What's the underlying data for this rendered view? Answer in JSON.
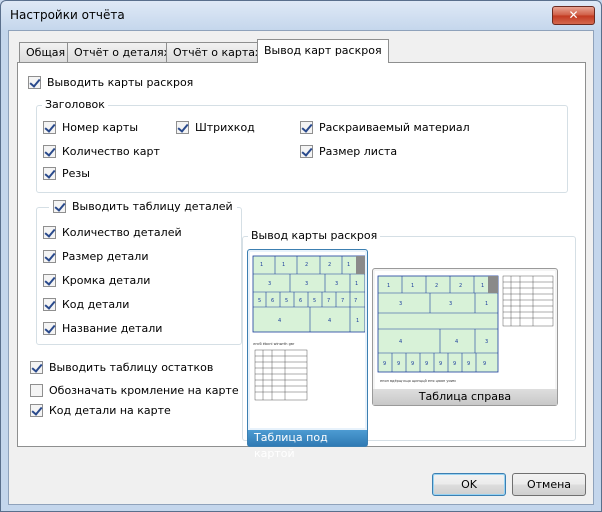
{
  "window": {
    "title": "Настройки отчёта",
    "close_glyph": "✕"
  },
  "tabs": [
    {
      "label": "Общая"
    },
    {
      "label": "Отчёт о деталях"
    },
    {
      "label": "Отчёт о картах"
    },
    {
      "label": "Вывод карт раскроя"
    }
  ],
  "active_tab": 3,
  "main": {
    "output_cards": {
      "label": "Выводить карты раскроя",
      "checked": true
    },
    "header_group": {
      "legend": "Заголовок",
      "items": [
        {
          "label": "Номер карты",
          "checked": true
        },
        {
          "label": "Количество карт",
          "checked": true
        },
        {
          "label": "Резы",
          "checked": true
        },
        {
          "label": "Штрихкод",
          "checked": true
        },
        {
          "label": "Раскраиваемый материал",
          "checked": true
        },
        {
          "label": "Размер листа",
          "checked": true
        }
      ]
    },
    "details_group": {
      "legend": "Выводить таблицу деталей",
      "legend_checked": true,
      "items": [
        {
          "label": "Количество деталей",
          "checked": true
        },
        {
          "label": "Размер детали",
          "checked": true
        },
        {
          "label": "Кромка детали",
          "checked": true
        },
        {
          "label": "Код детали",
          "checked": true
        },
        {
          "label": "Название детали",
          "checked": true
        }
      ]
    },
    "bottom_options": [
      {
        "label": "Выводить таблицу остатков",
        "checked": true
      },
      {
        "label": "Обозначать кромление на карте",
        "checked": false
      },
      {
        "label": "Код детали на карте",
        "checked": true
      }
    ],
    "layout_group": {
      "legend": "Вывод карты раскроя",
      "options": [
        {
          "label": "Таблица под картой",
          "selected": true
        },
        {
          "label": "Таблица справа",
          "selected": false
        }
      ]
    }
  },
  "footer": {
    "ok": "OK",
    "cancel": "Отмена"
  },
  "colors": {
    "accent": "#3c7fb1",
    "panel_fill": "#d8f2d8",
    "panel_stroke": "#1a3c9c"
  }
}
